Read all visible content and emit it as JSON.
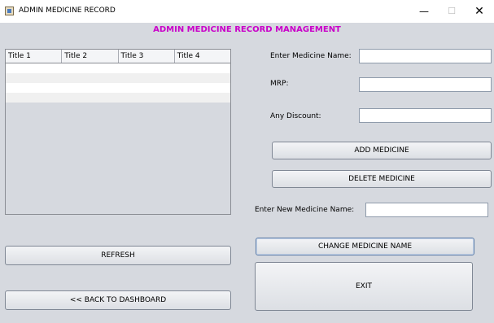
{
  "window": {
    "title": "ADMIN MEDICINE RECORD",
    "minimize": "—",
    "maximize": "☐",
    "close": "✕"
  },
  "heading": "ADMIN MEDICINE RECORD MANAGEMENT",
  "table": {
    "columns": [
      "Title 1",
      "Title 2",
      "Title 3",
      "Title 4"
    ]
  },
  "form": {
    "medicine_name_label": "Enter Medicine Name:",
    "medicine_name_value": "",
    "mrp_label": "MRP:",
    "mrp_value": "",
    "discount_label": "Any Discount:",
    "discount_value": "",
    "new_name_label": "Enter New Medicine Name:",
    "new_name_value": ""
  },
  "buttons": {
    "add": "ADD MEDICINE",
    "delete": "DELETE MEDICINE",
    "change": "CHANGE MEDICINE NAME",
    "exit": "EXIT",
    "refresh": "REFRESH",
    "back": "<< BACK TO DASHBOARD"
  }
}
